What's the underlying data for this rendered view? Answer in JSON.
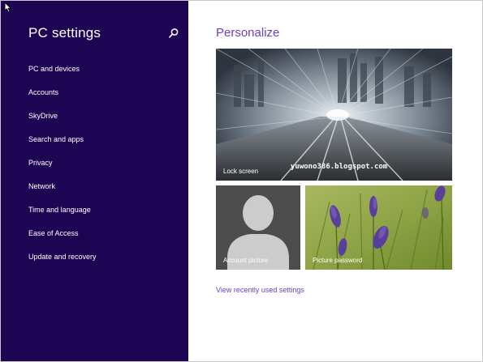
{
  "colors": {
    "sidebar_bg": "#1e0553",
    "accent": "#6b3fc4",
    "text_on_dark": "#ffffff"
  },
  "sidebar": {
    "title": "PC settings",
    "search_icon": "search-icon",
    "items": [
      {
        "label": "PC and devices"
      },
      {
        "label": "Accounts"
      },
      {
        "label": "SkyDrive"
      },
      {
        "label": "Search and apps"
      },
      {
        "label": "Privacy"
      },
      {
        "label": "Network"
      },
      {
        "label": "Time and language"
      },
      {
        "label": "Ease of Access"
      },
      {
        "label": "Update and recovery"
      }
    ]
  },
  "main": {
    "title": "Personalize",
    "tiles": {
      "lock_screen": {
        "label": "Lock screen",
        "watermark": "yuwono386.blogspot.com"
      },
      "account_picture": {
        "label": "Account picture",
        "icon": "user-silhouette-icon"
      },
      "picture_password": {
        "label": "Picture password"
      }
    },
    "recent_link": "View recently used settings"
  }
}
